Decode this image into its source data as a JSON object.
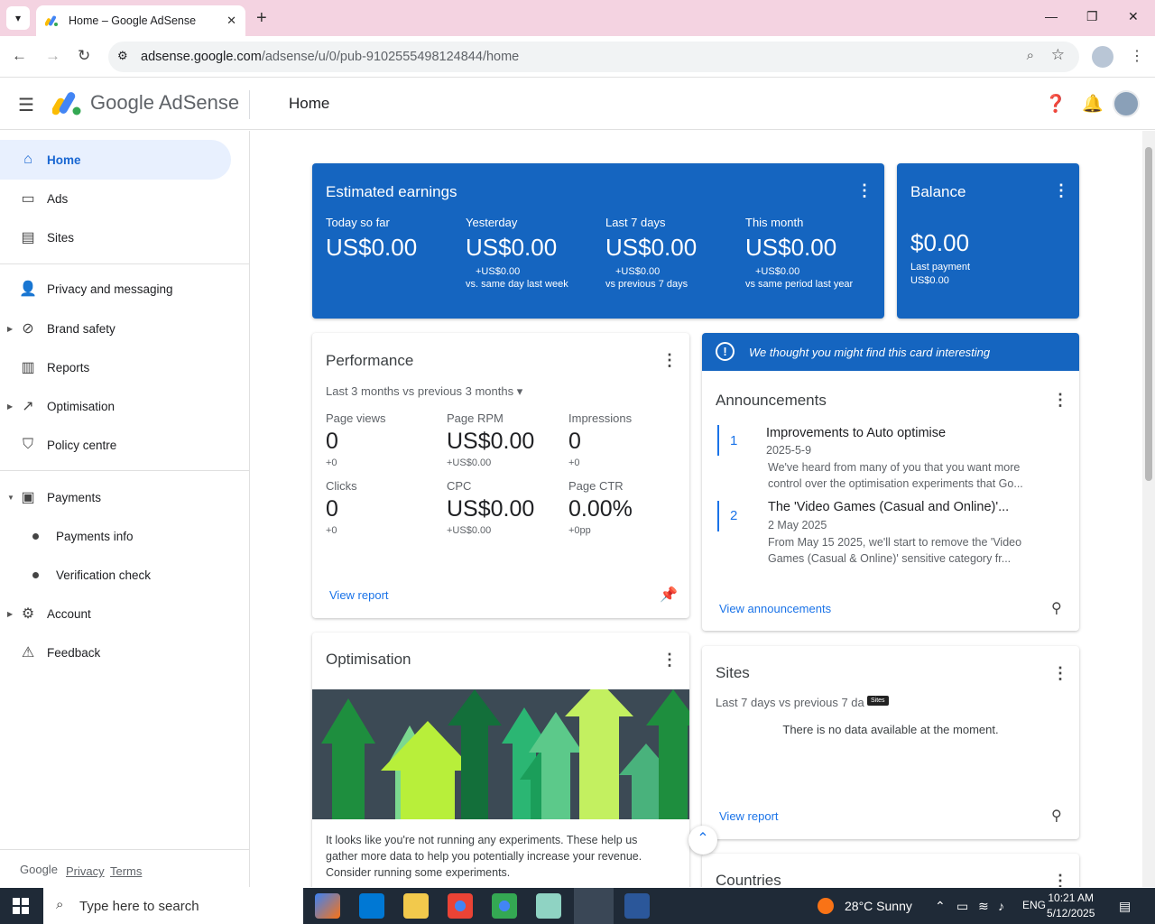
{
  "browser": {
    "tab_title": "Home – Google AdSense",
    "url_host": "adsense.google.com",
    "url_path": "/adsense/u/0/pub-9102555498124844/home"
  },
  "app": {
    "brand": "Google AdSense",
    "page_title": "Home"
  },
  "sidebar": {
    "items": [
      {
        "label": "Home",
        "icon": "home-icon"
      },
      {
        "label": "Ads",
        "icon": "ads-icon"
      },
      {
        "label": "Sites",
        "icon": "sites-icon"
      },
      {
        "label": "Privacy and messaging",
        "icon": "privacy-icon"
      },
      {
        "label": "Brand safety",
        "icon": "block-icon"
      },
      {
        "label": "Reports",
        "icon": "reports-icon"
      },
      {
        "label": "Optimisation",
        "icon": "trending-icon"
      },
      {
        "label": "Policy centre",
        "icon": "shield-icon"
      },
      {
        "label": "Payments",
        "icon": "payments-icon"
      },
      {
        "label": "Payments info"
      },
      {
        "label": "Verification check"
      },
      {
        "label": "Account",
        "icon": "gear-icon"
      },
      {
        "label": "Feedback",
        "icon": "feedback-icon"
      }
    ],
    "footer": {
      "google": "Google",
      "privacy": "Privacy",
      "terms": "Terms"
    }
  },
  "earnings": {
    "title": "Estimated earnings",
    "metrics": [
      {
        "label": "Today so far",
        "value": "US$0.00",
        "delta": "",
        "note": ""
      },
      {
        "label": "Yesterday",
        "value": "US$0.00",
        "delta": "+US$0.00",
        "note": "vs. same day last week"
      },
      {
        "label": "Last 7 days",
        "value": "US$0.00",
        "delta": "+US$0.00",
        "note": "vs previous 7 days"
      },
      {
        "label": "This month",
        "value": "US$0.00",
        "delta": "+US$0.00",
        "note": "vs same period last year"
      }
    ]
  },
  "balance": {
    "title": "Balance",
    "value": "$0.00",
    "last_payment_label": "Last payment",
    "last_payment_value": "US$0.00"
  },
  "performance": {
    "title": "Performance",
    "range": "Last 3 months vs previous 3 months",
    "metrics": [
      {
        "label": "Page views",
        "value": "0",
        "delta": "+0"
      },
      {
        "label": "Page RPM",
        "value": "US$0.00",
        "delta": "+US$0.00"
      },
      {
        "label": "Impressions",
        "value": "0",
        "delta": "+0"
      },
      {
        "label": "Clicks",
        "value": "0",
        "delta": "+0"
      },
      {
        "label": "CPC",
        "value": "US$0.00",
        "delta": "+US$0.00"
      },
      {
        "label": "Page CTR",
        "value": "0.00%",
        "delta": "+0pp"
      }
    ],
    "link": "View report"
  },
  "announcements": {
    "banner": "We thought you might find this card interesting",
    "title": "Announcements",
    "items": [
      {
        "num": "1",
        "title": "Improvements to Auto optimise",
        "date": "2025-5-9",
        "body": "We've heard from many of you that you want more control over the optimisation experiments that Go..."
      },
      {
        "num": "2",
        "title": "The 'Video Games (Casual and Online)'...",
        "date": "2 May 2025",
        "body": "From May 15 2025, we'll start to remove the 'Video Games (Casual & Online)' sensitive category fr..."
      }
    ],
    "link": "View announcements"
  },
  "optimisation": {
    "title": "Optimisation",
    "body": "It looks like you're not running any experiments. These help us gather more data to help you potentially increase your revenue. Consider running some experiments."
  },
  "sites": {
    "title": "Sites",
    "range": "Last 7 days vs previous 7 da",
    "tooltip": "Sites",
    "empty": "There is no data available at the moment.",
    "link": "View report"
  },
  "countries": {
    "title": "Countries"
  },
  "taskbar": {
    "search_placeholder": "Type here to search",
    "weather": "28°C  Sunny",
    "lang": "ENG",
    "time": "10:21 AM",
    "date": "5/12/2025"
  }
}
